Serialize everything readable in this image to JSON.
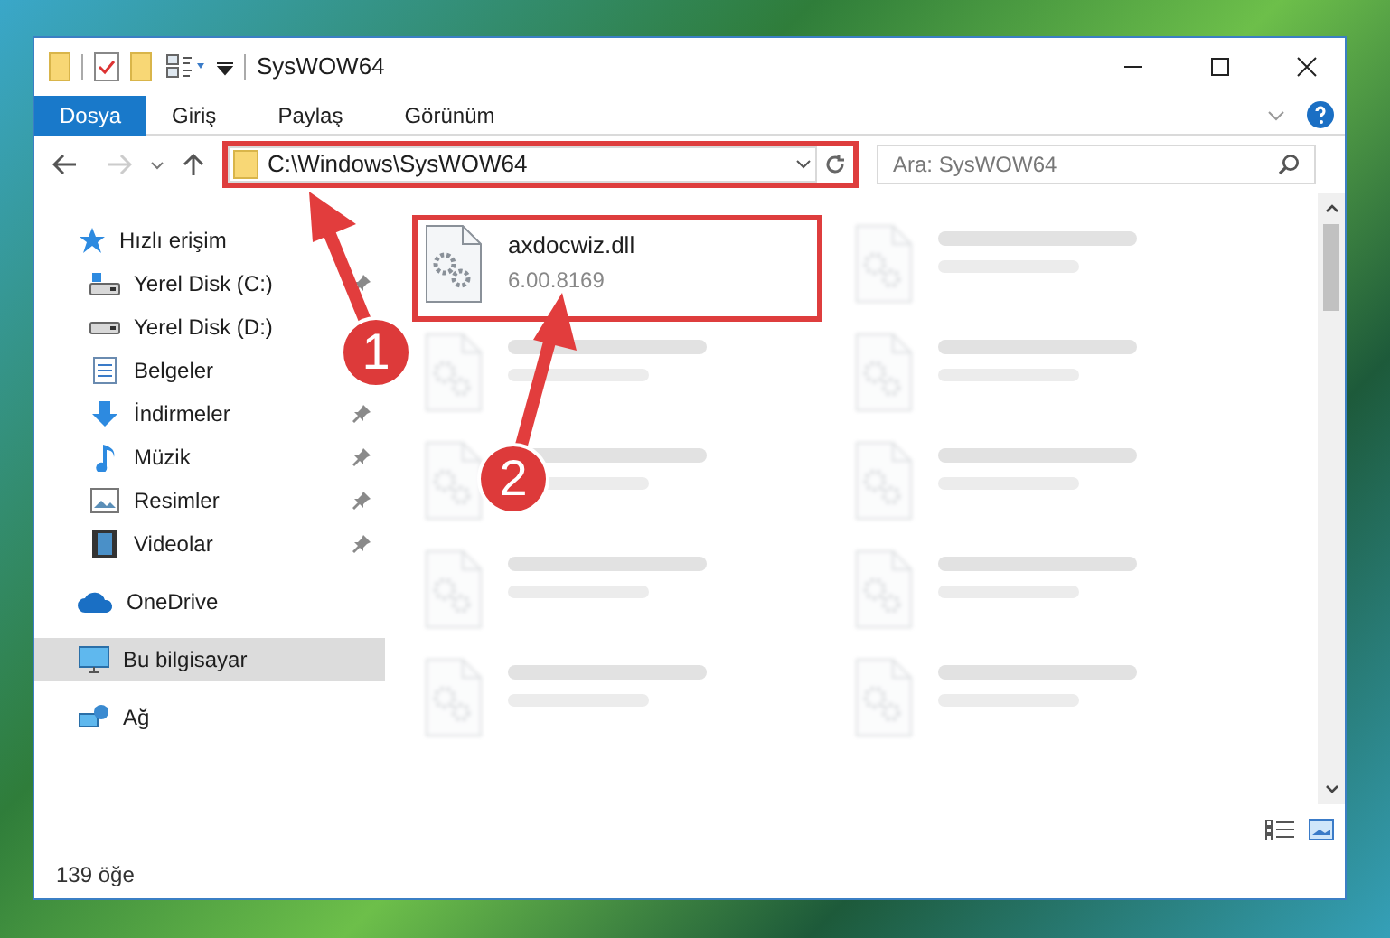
{
  "window": {
    "title": "SysWOW64"
  },
  "ribbon": {
    "tabs": [
      {
        "label": "Dosya",
        "selected": true
      },
      {
        "label": "Giriş",
        "selected": false
      },
      {
        "label": "Paylaş",
        "selected": false
      },
      {
        "label": "Görünüm",
        "selected": false
      }
    ]
  },
  "address_bar": {
    "path": "C:\\Windows\\SysWOW64",
    "highlighted": true
  },
  "search": {
    "placeholder": "Ara: SysWOW64"
  },
  "sidebar": {
    "items": [
      {
        "label": "Hızlı erişim",
        "selected": false,
        "children": [
          {
            "label": "Yerel Disk (C:)",
            "pinned": true
          },
          {
            "label": "Yerel Disk (D:)"
          },
          {
            "label": "Belgeler"
          },
          {
            "label": "İndirmeler",
            "pinned": true
          },
          {
            "label": "Müzik",
            "pinned": true
          },
          {
            "label": "Resimler",
            "pinned": true
          },
          {
            "label": "Videolar",
            "pinned": true
          }
        ]
      },
      {
        "label": "OneDrive",
        "selected": false
      },
      {
        "label": "Bu bilgisayar",
        "selected": true
      },
      {
        "label": "Ağ",
        "selected": false
      }
    ]
  },
  "files": [
    {
      "name": "axdocwiz.dll",
      "detail": "6.00.8169",
      "blurred": false,
      "highlighted": true
    },
    {
      "blurred": true,
      "highlighted": false
    },
    {
      "blurred": true,
      "highlighted": false
    },
    {
      "blurred": true,
      "highlighted": false
    },
    {
      "blurred": true,
      "highlighted": false
    },
    {
      "blurred": true,
      "highlighted": false
    },
    {
      "blurred": true,
      "highlighted": false
    },
    {
      "blurred": true,
      "highlighted": false
    },
    {
      "blurred": true,
      "highlighted": false
    },
    {
      "blurred": true,
      "highlighted": false
    }
  ],
  "status_bar": {
    "count": "139 öğe"
  },
  "annotations": [
    {
      "number": "1"
    },
    {
      "number": "2"
    }
  ]
}
